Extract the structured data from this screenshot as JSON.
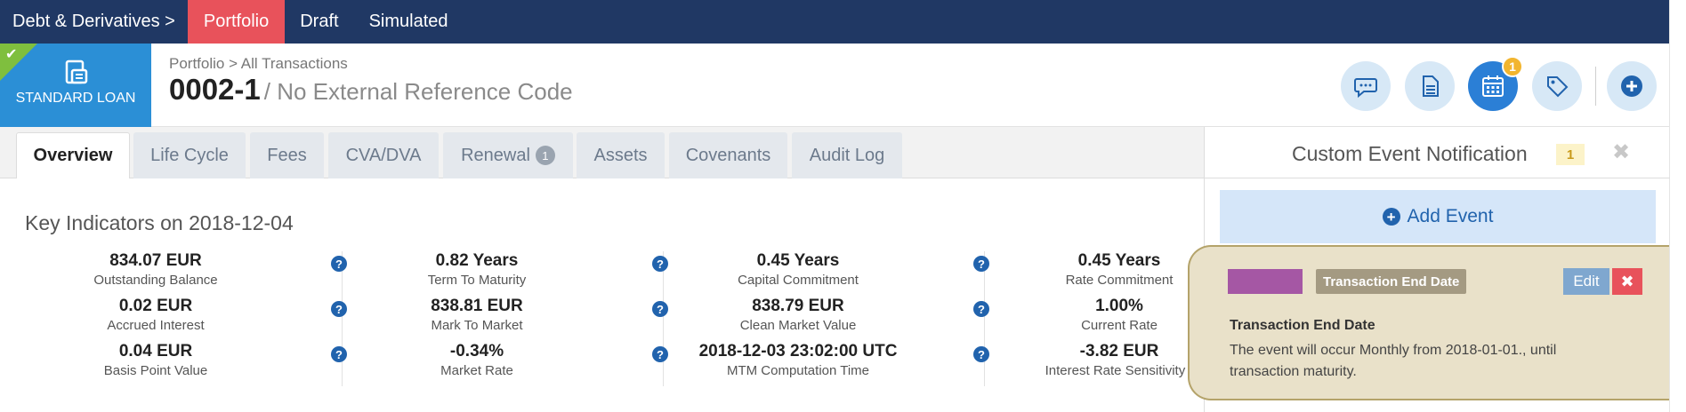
{
  "topnav": {
    "breadcrumb": "Debt & Derivatives >",
    "tabs": [
      {
        "label": "Portfolio",
        "active": true
      },
      {
        "label": "Draft",
        "active": false
      },
      {
        "label": "Simulated",
        "active": false
      }
    ]
  },
  "header": {
    "loan_type": "STANDARD LOAN",
    "breadcrumb": "Portfolio > All Transactions",
    "transaction_code": "0002-1",
    "reference": "/ No External Reference Code",
    "actions": [
      {
        "icon": "comment-icon"
      },
      {
        "icon": "document-icon"
      },
      {
        "icon": "calendar-icon",
        "badge": "1",
        "active": true
      },
      {
        "icon": "tag-icon"
      },
      {
        "icon": "plus-circle-icon"
      }
    ]
  },
  "tabs": [
    {
      "label": "Overview",
      "active": true
    },
    {
      "label": "Life Cycle"
    },
    {
      "label": "Fees"
    },
    {
      "label": "CVA/DVA"
    },
    {
      "label": "Renewal",
      "count": "1"
    },
    {
      "label": "Assets"
    },
    {
      "label": "Covenants"
    },
    {
      "label": "Audit Log"
    }
  ],
  "key_indicators": {
    "title": "Key Indicators on 2018-12-04",
    "columns": [
      [
        {
          "value": "834.07 EUR",
          "label": "Outstanding Balance"
        },
        {
          "value": "0.02 EUR",
          "label": "Accrued Interest"
        },
        {
          "value": "0.04 EUR",
          "label": "Basis Point Value"
        }
      ],
      [
        {
          "value": "0.82 Years",
          "label": "Term To Maturity"
        },
        {
          "value": "838.81 EUR",
          "label": "Mark To Market"
        },
        {
          "value": "-0.34%",
          "label": "Market Rate"
        }
      ],
      [
        {
          "value": "0.45 Years",
          "label": "Capital Commitment"
        },
        {
          "value": "838.79 EUR",
          "label": "Clean Market Value"
        },
        {
          "value": "2018-12-03 23:02:00 UTC",
          "label": "MTM Computation Time"
        }
      ],
      [
        {
          "value": "0.45 Years",
          "label": "Rate Commitment"
        },
        {
          "value": "1.00%",
          "label": "Current Rate"
        },
        {
          "value": "-3.82 EUR",
          "label": "Interest Rate Sensitivity ("
        }
      ]
    ]
  },
  "side_panel": {
    "title": "Custom Event Notification",
    "count": "1",
    "close": "✖",
    "add_event": "Add Event"
  },
  "event": {
    "badge": "Transaction End Date",
    "edit": "Edit",
    "delete": "✖",
    "name": "Transaction End Date",
    "description": "The event will occur Monthly from 2018-01-01., until transaction maturity.",
    "swatch_color": "#a557a4"
  },
  "colors": {
    "nav_bg": "#203864",
    "accent_red": "#e8525b",
    "primary_blue": "#2b8fd6"
  }
}
